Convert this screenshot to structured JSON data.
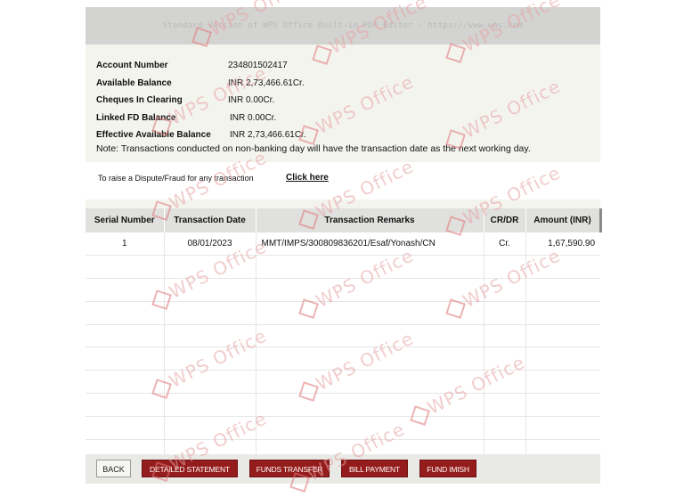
{
  "banner_text": "Standard Version of WPS Office Built-in PDF Editor - https://www.wps.com",
  "account": [
    {
      "label": "Account Number",
      "value": "234801502417"
    },
    {
      "label": "Available Balance",
      "value": "INR 2,73,466.61Cr."
    },
    {
      "label": "Cheques In Clearing",
      "value": "INR 0.00Cr."
    },
    {
      "label": "Linked FD Balance",
      "value": "INR 0.00Cr."
    },
    {
      "label": "Effective Available Balance",
      "value": "INR 2,73,466.61Cr."
    }
  ],
  "note": "Note: Transactions conducted on non-banking day will have the transaction date as the next working day.",
  "dispute": {
    "text": "To raise a Dispute/Fraud for any transaction",
    "link": "Click here"
  },
  "table": {
    "headers": [
      "Serial Number",
      "Transaction Date",
      "Transaction Remarks",
      "CR/DR",
      "Amount (INR)"
    ],
    "rows": [
      [
        "1",
        "08/01/2023",
        "MMT/IMPS/300809836201/Esaf/Yonash/CN",
        "Cr.",
        "1,67,590.90"
      ]
    ]
  },
  "buttons": {
    "back": "BACK",
    "detailed_statement": "DETAILED STATEMENT",
    "funds_transfer": "FUNDS TRANSFER",
    "bill_payment": "BILL PAYMENT",
    "fund_imish": "FUND IMISH"
  },
  "watermark": "WPS Office"
}
